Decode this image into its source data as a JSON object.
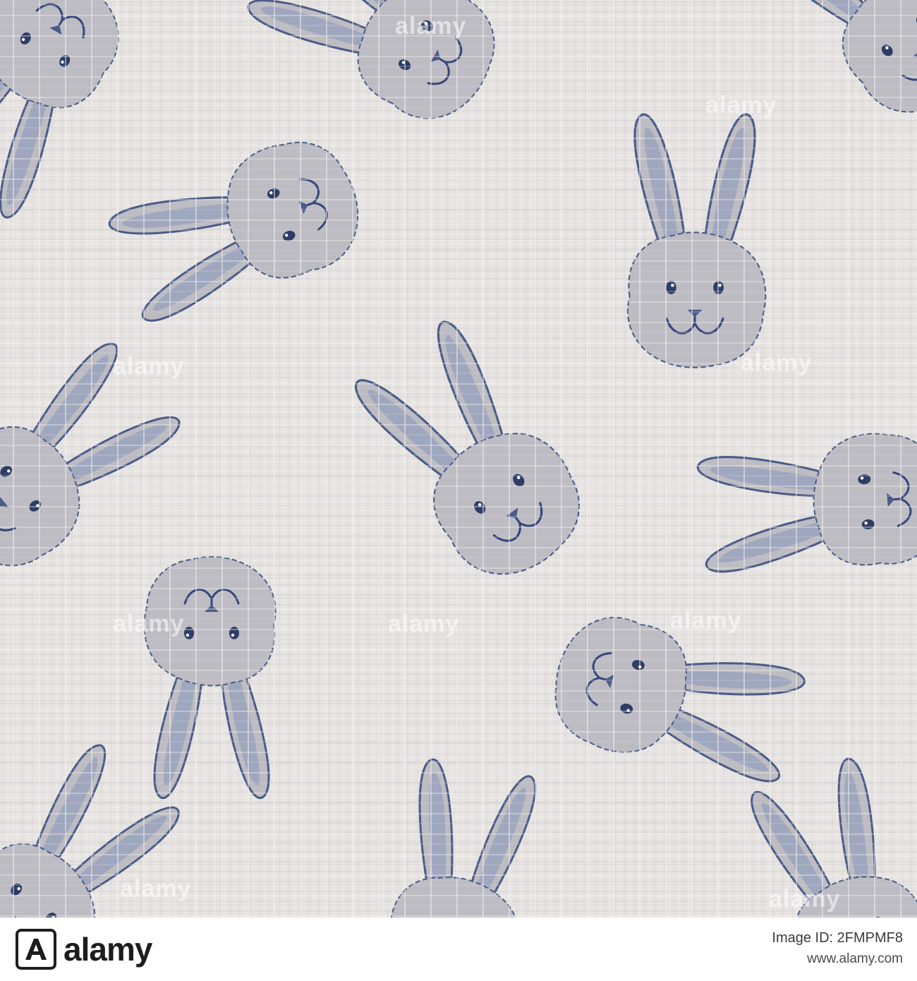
{
  "watermark": {
    "text": "alamy"
  },
  "footer": {
    "brand": "alamy",
    "image_id_label": "Image ID: 2FMPMF8",
    "url": "www.alamy.com"
  },
  "colors": {
    "fabric": "#e6e3e0",
    "bunny_fill": "#bdbcc3",
    "ear_inner": "#9aa3bd",
    "outline": "#4a5c86",
    "footer_bg": "#ffffff",
    "brand_text": "#1d1d1d"
  }
}
